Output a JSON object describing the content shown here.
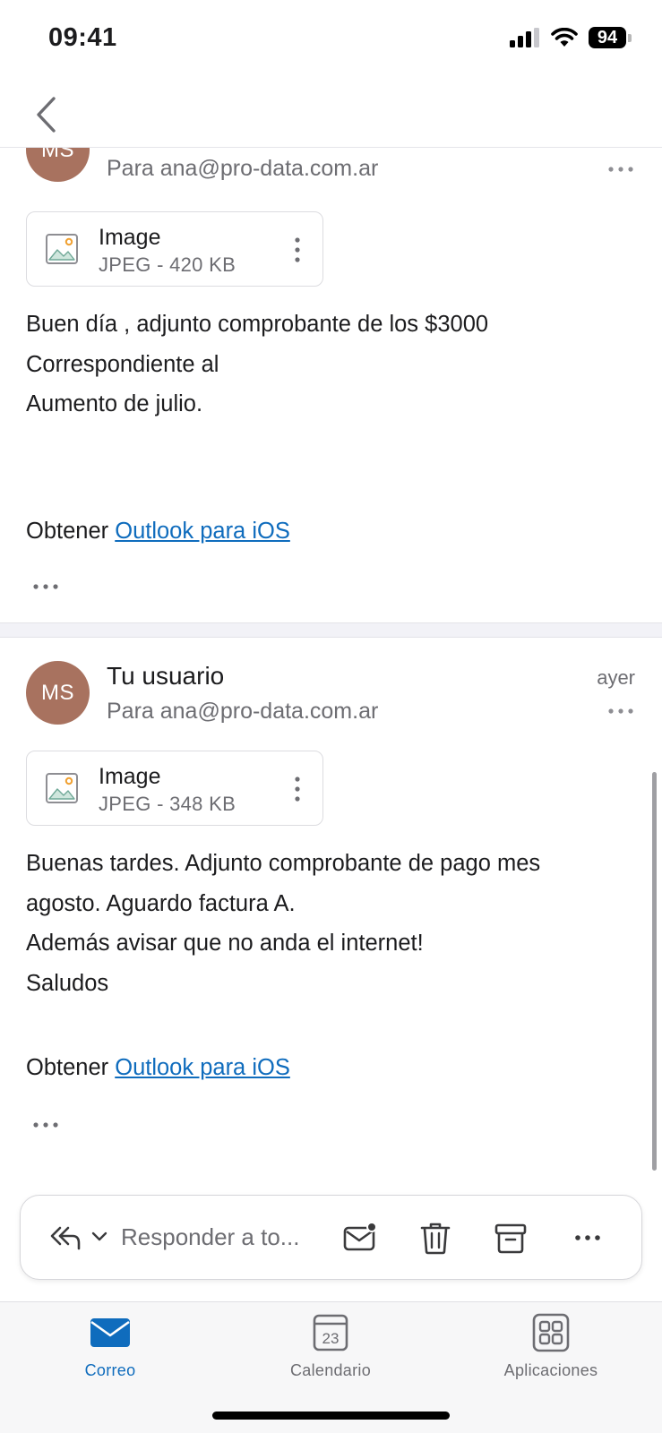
{
  "status_bar": {
    "time": "09:41",
    "battery": "94"
  },
  "messages": [
    {
      "avatar_initials": "MS",
      "recipient": "Para ana@pro-data.com.ar",
      "attachment": {
        "name": "Image",
        "meta": "JPEG - 420 KB"
      },
      "body_lines": [
        "Buen día , adjunto comprobante de los $3000",
        "Correspondiente al",
        "Aumento de julio."
      ],
      "footer_prefix": "Obtener",
      "footer_link": "Outlook para iOS"
    },
    {
      "avatar_initials": "MS",
      "sender": "Tu usuario",
      "date": "ayer",
      "recipient": "Para ana@pro-data.com.ar",
      "attachment": {
        "name": "Image",
        "meta": "JPEG - 348 KB"
      },
      "body_lines": [
        "Buenas tardes. Adjunto comprobante de pago mes",
        "agosto. Aguardo factura A.",
        "Además avisar que no anda el internet!",
        "Saludos"
      ],
      "footer_prefix": "Obtener",
      "footer_link": "Outlook para iOS"
    }
  ],
  "action_bar": {
    "reply_label": "Responder a to...",
    "icons": [
      "reply-all-icon",
      "chevron-down-icon",
      "mark-unread-icon",
      "trash-icon",
      "archive-icon",
      "more-icon"
    ]
  },
  "tabs": [
    {
      "label": "Correo",
      "icon": "mail-icon",
      "active": true
    },
    {
      "label": "Calendario",
      "icon": "calendar-icon",
      "day": "23"
    },
    {
      "label": "Aplicaciones",
      "icon": "apps-icon"
    }
  ],
  "colors": {
    "accent": "#0f6cbd",
    "avatar": "#a8725f",
    "secondary_text": "#6d6d72"
  }
}
